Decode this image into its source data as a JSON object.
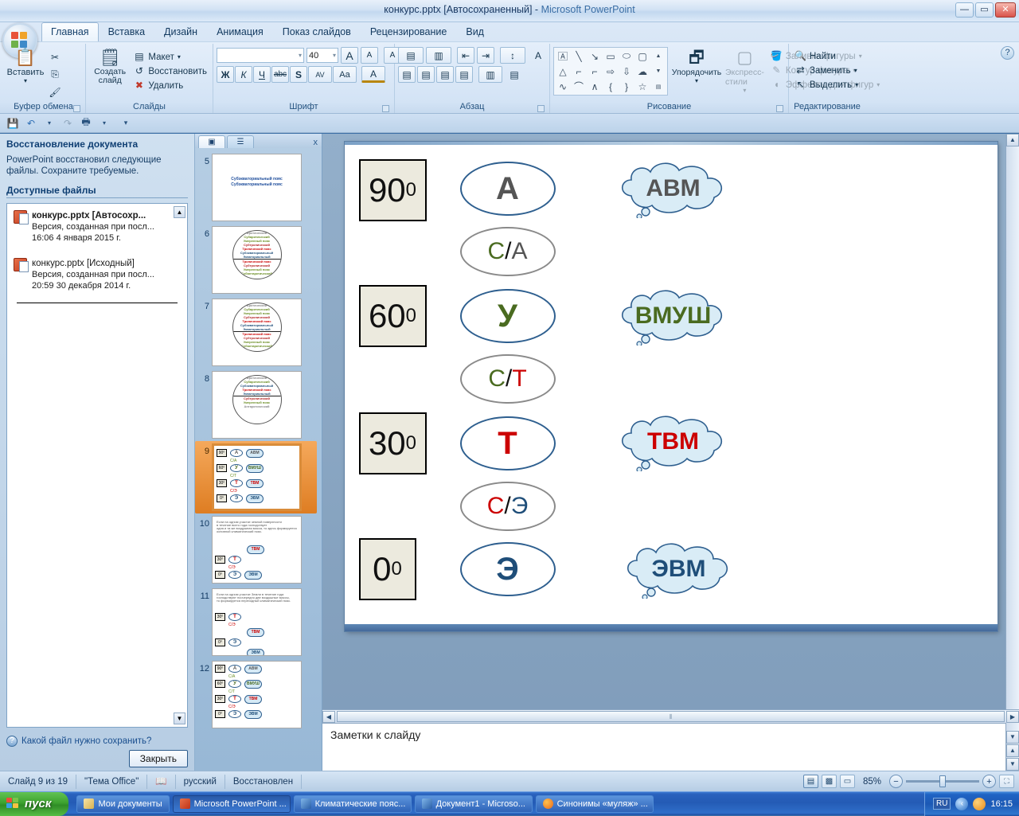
{
  "titlebar": {
    "document": "конкурс.pptx [Автосохраненный]",
    "dash": "-",
    "app": "Microsoft PowerPoint",
    "minimize": "—",
    "maximize": "▭",
    "close": "✕"
  },
  "ribbon": {
    "help_label": "?",
    "tabs": [
      {
        "label": "Главная",
        "active": true
      },
      {
        "label": "Вставка",
        "active": false
      },
      {
        "label": "Дизайн",
        "active": false
      },
      {
        "label": "Анимация",
        "active": false
      },
      {
        "label": "Показ слайдов",
        "active": false
      },
      {
        "label": "Рецензирование",
        "active": false
      },
      {
        "label": "Вид",
        "active": false
      }
    ],
    "groups": {
      "clipboard": {
        "label": "Буфер обмена",
        "paste": "Вставить",
        "cut": "✂",
        "copy": "⎘",
        "format_painter": "🖌"
      },
      "slides": {
        "label": "Слайды",
        "new_slide": "Создать слайд",
        "layout": "Макет",
        "reset": "Восстановить",
        "delete": "Удалить"
      },
      "font": {
        "label": "Шрифт",
        "font_name": "",
        "font_size": "40",
        "grow": "A",
        "shrink": "A",
        "clear_format": "A",
        "bold": "Ж",
        "italic": "К",
        "underline": "Ч",
        "strikethrough": "abc",
        "shadow": "S",
        "spacing": "AV",
        "change_case": "Aa",
        "font_color": "A"
      },
      "paragraph": {
        "label": "Абзац",
        "bullets": "▤",
        "numbering": "▥",
        "decrease_indent": "⇤",
        "increase_indent": "⇥",
        "line_spacing": "↕",
        "text_direction": "A",
        "align_text": "▤",
        "smartart": "▤",
        "align_left": "▤",
        "align_center": "▤",
        "align_right": "▤",
        "justify": "▤",
        "columns": "▥"
      },
      "drawing": {
        "label": "Рисование",
        "arrange": "Упорядочить",
        "quick_styles": "Экспресс-стили",
        "shape_fill": "Заливка фигуры",
        "shape_outline": "Контур фигуры",
        "shape_effects": "Эффекты для фигур"
      },
      "editing": {
        "label": "Редактирование",
        "find": "Найти",
        "replace": "Заменить",
        "select": "Выделить"
      }
    }
  },
  "qat": {
    "save": "💾",
    "undo": "↶",
    "redo": "↷",
    "print": "🖶",
    "customize": "▾"
  },
  "recovery_pane": {
    "title": "Восстановление документа",
    "description": "PowerPoint восстановил следующие файлы. Сохраните требуемые.",
    "subtitle": "Доступные файлы",
    "files": [
      {
        "name": "конкурс.pptx  [Автосохр...",
        "version": "Версия, созданная при посл...",
        "timestamp": "16:06 4 января 2015 г.",
        "bold": true
      },
      {
        "name": "конкурс.pptx  [Исходный]",
        "version": "Версия, созданная при посл...",
        "timestamp": "20:59 30 декабря 2014 г.",
        "bold": false
      }
    ],
    "help_link": "Какой файл нужно сохранить?",
    "close_button": "Закрыть",
    "scroll_up": "▲",
    "scroll_down": "▼"
  },
  "thumbnails_pane": {
    "tab_slides": "▣",
    "tab_outline": "☰",
    "close": "x",
    "scroll_up": "▲",
    "scroll_down": "▼",
    "slides": [
      {
        "number": "5",
        "selected": false,
        "kind": "title"
      },
      {
        "number": "6",
        "selected": false,
        "kind": "circle"
      },
      {
        "number": "7",
        "selected": false,
        "kind": "circle"
      },
      {
        "number": "8",
        "selected": false,
        "kind": "circle"
      },
      {
        "number": "9",
        "selected": true,
        "kind": "belts"
      },
      {
        "number": "10",
        "selected": false,
        "kind": "text-belts"
      },
      {
        "number": "11",
        "selected": false,
        "kind": "text-belts"
      },
      {
        "number": "12",
        "selected": false,
        "kind": "belts"
      }
    ],
    "title_slide_text": "Субэкваториальный пояс Субэкваториальный пояс"
  },
  "slide": {
    "rows": [
      {
        "degree": "90",
        "degree_sup": "0",
        "letter": "А",
        "letter_color": "#555555",
        "cloud": "АВМ",
        "cloud_color": "#555555",
        "has_cloud": true
      },
      {
        "degree": "60",
        "degree_sup": "0",
        "letter": "У",
        "letter_color": "#4a6b20",
        "cloud": "ВМУШ",
        "cloud_color": "#4a6b20",
        "has_cloud": true
      },
      {
        "degree": "30",
        "degree_sup": "0",
        "letter": "Т",
        "letter_color": "#cc0000",
        "cloud": "ТВМ",
        "cloud_color": "#cc0000",
        "has_cloud": true
      },
      {
        "degree": "0",
        "degree_sup": "0",
        "letter": "Э",
        "letter_color": "#1f4e79",
        "cloud": "ЭВМ",
        "cloud_color": "#1f4e79",
        "has_cloud": true
      }
    ],
    "transitions": [
      {
        "left": "С",
        "left_color": "#4a6b20",
        "slash": "/",
        "right": "А",
        "right_color": "#555555"
      },
      {
        "left": "С",
        "left_color": "#4a6b20",
        "slash": "/",
        "right": "Т",
        "right_color": "#cc0000"
      },
      {
        "left": "С",
        "left_color": "#cc0000",
        "slash": "/",
        "right": "Э",
        "right_color": "#1f4e79"
      }
    ]
  },
  "notes": {
    "placeholder": "Заметки к слайду"
  },
  "scrollbars": {
    "up": "▲",
    "down": "▼",
    "left": "◀",
    "right": "▶",
    "grip": "⦀"
  },
  "status_bar": {
    "slide_counter": "Слайд 9 из 19",
    "theme": "\"Тема Office\"",
    "language": "русский",
    "state": "Восстановлен",
    "spell_icon": "✓",
    "view_normal": "▤",
    "view_sorter": "▩",
    "view_show": "▭",
    "zoom_level": "85%",
    "zoom_out": "−",
    "zoom_in": "+",
    "fit_to_window": "⛶"
  },
  "taskbar": {
    "start": "пуск",
    "items": [
      {
        "label": "Мои документы",
        "icon": "docs",
        "active": false
      },
      {
        "label": "Microsoft PowerPoint ...",
        "icon": "ppt",
        "active": true
      },
      {
        "label": "Климатические пояс...",
        "icon": "word",
        "active": false
      },
      {
        "label": "Документ1 - Microso...",
        "icon": "word",
        "active": false
      },
      {
        "label": "Синонимы «муляж» ...",
        "icon": "ff",
        "active": false
      }
    ],
    "lang": "RU",
    "clock": "16:15"
  }
}
